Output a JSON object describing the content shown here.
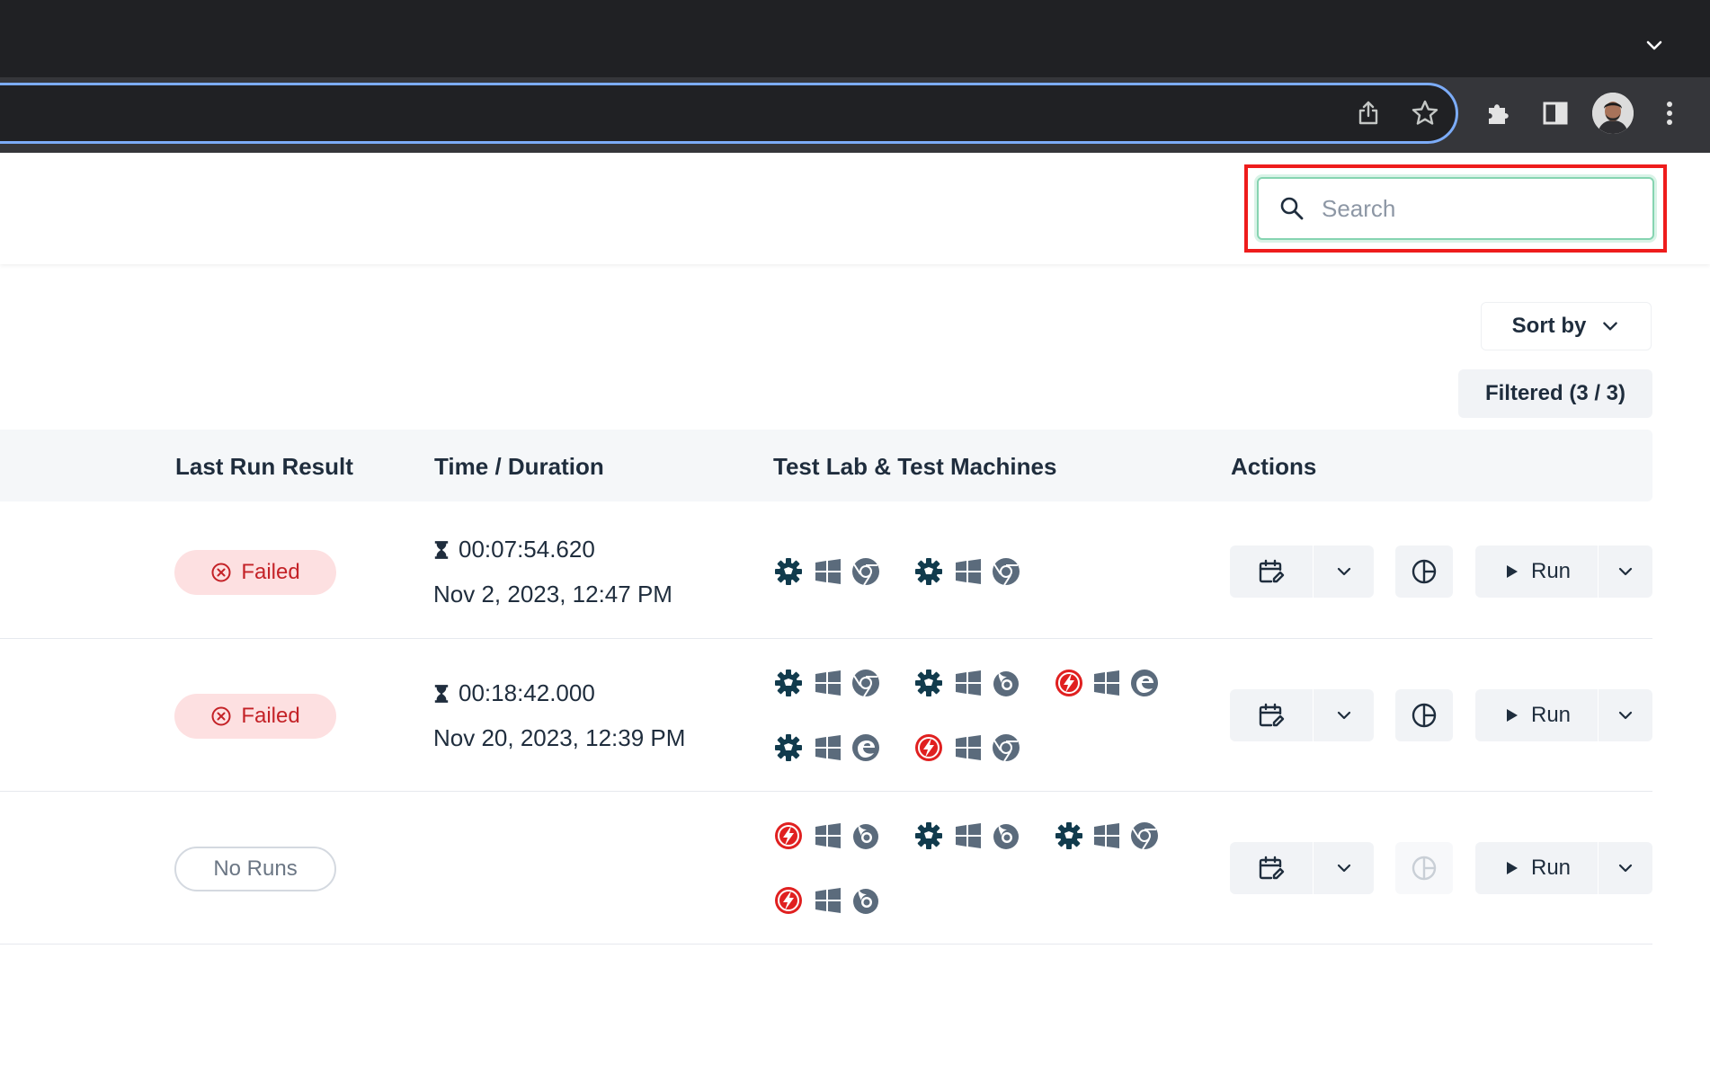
{
  "browser": {
    "share_icon": "share-icon",
    "bookmark_icon": "star-icon",
    "extensions_icon": "puzzle-icon",
    "sidepanel_icon": "side-panel-icon",
    "menu_icon": "kebab-menu-icon"
  },
  "search": {
    "placeholder": "Search"
  },
  "toolbar": {
    "sort_label": "Sort by",
    "filtered_label": "Filtered (3 / 3)"
  },
  "table": {
    "headers": [
      "Last Run Result",
      "Time / Duration",
      "Test Lab & Test Machines",
      "Actions"
    ],
    "rows": [
      {
        "result": "Failed",
        "duration": "00:07:54.620",
        "date": "Nov 2, 2023, 12:47 PM",
        "run_label": "Run"
      },
      {
        "result": "Failed",
        "duration": "00:18:42.000",
        "date": "Nov 20, 2023, 12:39 PM",
        "run_label": "Run"
      },
      {
        "result": "No Runs",
        "duration": "",
        "date": "",
        "run_label": "Run"
      }
    ]
  },
  "colors": {
    "failed_bg": "#fde0e1",
    "failed_text": "#c42227",
    "lab_gear": "#113b4d",
    "lab_bolt": "#e02020",
    "os_icon": "#5b6b7c",
    "accent_focus": "#86d4b1"
  }
}
